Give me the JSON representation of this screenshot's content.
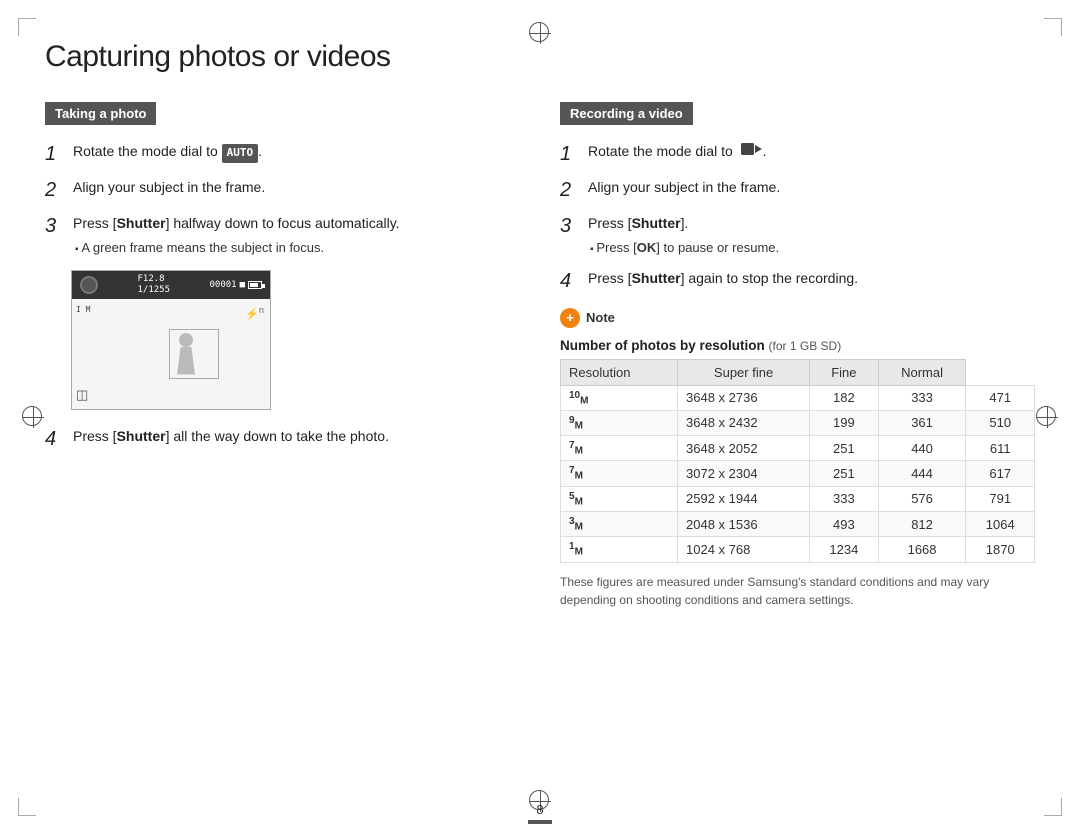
{
  "page": {
    "title": "Capturing photos or videos",
    "number": "8"
  },
  "left_section": {
    "header": "Taking a photo",
    "steps": [
      {
        "num": "1",
        "text": "Rotate the mode dial to ",
        "badge": "AUTO",
        "after": "."
      },
      {
        "num": "2",
        "text": "Align your subject in the frame."
      },
      {
        "num": "3",
        "text": "Press [",
        "bold_word": "Shutter",
        "after_bold": "] halfway down to focus automatically.",
        "sub_bullet": "A green frame means the subject in focus."
      },
      {
        "num": "4",
        "text": "Press [",
        "bold_word": "Shutter",
        "after_bold": "] all the way down to take the photo."
      }
    ],
    "camera_display": {
      "f_number": "F12.8",
      "shutter": "1/1255",
      "counter": "00001"
    }
  },
  "right_section": {
    "header": "Recording a video",
    "steps": [
      {
        "num": "1",
        "text": "Rotate the mode dial to ",
        "has_video_icon": true,
        "after": "."
      },
      {
        "num": "2",
        "text": "Align your subject in the frame."
      },
      {
        "num": "3",
        "text": "Press [",
        "bold_word": "Shutter",
        "after_bold": "].",
        "sub_bullet": "Press [OK] to pause or resume."
      },
      {
        "num": "4",
        "text": "Press [",
        "bold_word": "Shutter",
        "after_bold": "] again to stop the recording."
      }
    ],
    "note_label": "Note",
    "table_title": "Number of photos by resolution",
    "table_subtitle": "(for 1 GB SD)",
    "table_headers": [
      "Resolution",
      "Super fine",
      "Fine",
      "Normal"
    ],
    "table_rows": [
      {
        "label": "10M",
        "resolution": "3648 x 2736",
        "super_fine": "182",
        "fine": "333",
        "normal": "471"
      },
      {
        "label": "9M",
        "resolution": "3648 x 2432",
        "super_fine": "199",
        "fine": "361",
        "normal": "510"
      },
      {
        "label": "7M",
        "resolution": "3648 x 2052",
        "super_fine": "251",
        "fine": "440",
        "normal": "611"
      },
      {
        "label": "7M",
        "resolution": "3072 x 2304",
        "super_fine": "251",
        "fine": "444",
        "normal": "617"
      },
      {
        "label": "5M",
        "resolution": "2592 x 1944",
        "super_fine": "333",
        "fine": "576",
        "normal": "791"
      },
      {
        "label": "3M",
        "resolution": "2048 x 1536",
        "super_fine": "493",
        "fine": "812",
        "normal": "1064"
      },
      {
        "label": "1M",
        "resolution": "1024 x 768",
        "super_fine": "1234",
        "fine": "1668",
        "normal": "1870"
      }
    ],
    "footnote": "These figures are measured under Samsung's standard conditions and may vary depending on shooting conditions and camera settings."
  }
}
